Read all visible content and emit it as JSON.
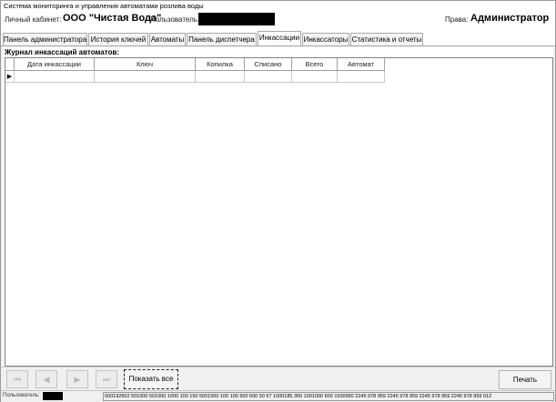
{
  "window": {
    "title": "Система мониторинга и управления автоматами розлива воды"
  },
  "info": {
    "cabinet_label": "Личный кабинет:",
    "cabinet_value": "ООО \"Чистая Вода\"",
    "user_label": "Пользователь:",
    "rights_label": "Права:",
    "rights_value": "Администратор"
  },
  "tabs": [
    {
      "label": "Панель администратора"
    },
    {
      "label": "История ключей"
    },
    {
      "label": "Автоматы"
    },
    {
      "label": "Панель диспетчера"
    },
    {
      "label": "Инкассации",
      "active": true
    },
    {
      "label": "Инкассаторы"
    },
    {
      "label": "Статистика и отчеты"
    }
  ],
  "journal": {
    "title": "Журнал инкассаций автоматов:",
    "columns": [
      "Дата инкассации",
      "Ключ",
      "Копилка",
      "Списано",
      "Всего",
      "Автомат"
    ],
    "row_indicator": "▶"
  },
  "bottom": {
    "nav_icons": [
      "first-icon",
      "prev-icon",
      "next-icon",
      "last-icon"
    ],
    "nav_glyphs": [
      "⏮",
      "◀",
      "▶",
      "⏭"
    ],
    "show_all_label": "Показать все",
    "print_label": "Печать"
  },
  "status": {
    "label": "Пользователь:",
    "codes": "000192602 501000 501000 1000 100 150 5001000 100 100 500 500 50 57 1000185 300 1001000 600 1500950 2245 978 959 2245 978 959 2245 978 959 2245 978 959 012"
  }
}
